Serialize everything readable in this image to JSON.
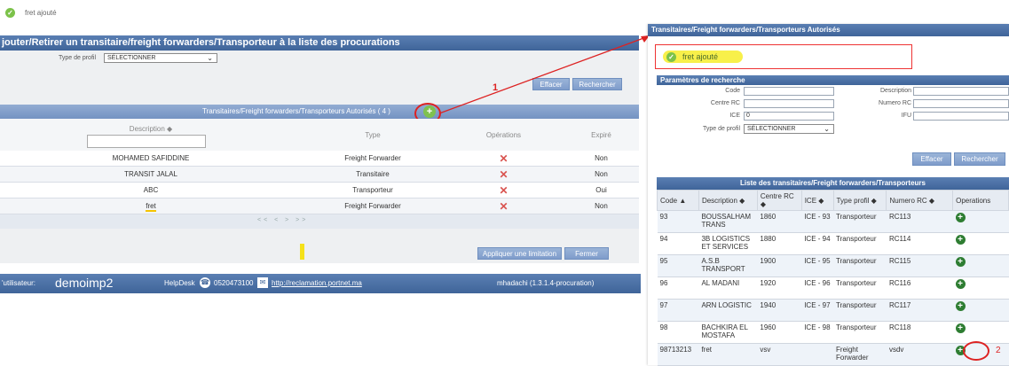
{
  "top_notice": {
    "text": "fret ajouté"
  },
  "left": {
    "title": "jouter/Retirer un transitaire/freight forwarders/Transporteur à la liste des procurations",
    "profile_label": "Type de profil",
    "profile_value": "SÉLECTIONNER",
    "clear_btn": "Effacer",
    "search_btn": "Rechercher",
    "grid_title": "Transitaires/Freight forwarders/Transporteurs Autorisés ( 4 )",
    "col_description": "Description",
    "col_type": "Type",
    "col_operations": "Opérations",
    "col_expire": "Expiré",
    "rows": [
      {
        "description": "MOHAMED SAFIDDINE",
        "type": "Freight Forwarder",
        "expire": "Non"
      },
      {
        "description": "TRANSIT JALAL",
        "type": "Transitaire",
        "expire": "Non"
      },
      {
        "description": "ABC",
        "type": "Transporteur",
        "expire": "Oui"
      },
      {
        "description": "fret",
        "type": "Freight Forwarder",
        "expire": "Non"
      }
    ],
    "pager": "<< < > >>",
    "apply_btn": "Appliquer une limitation",
    "close_btn": "Fermer"
  },
  "footer": {
    "user_label": "'utilisateur:",
    "user_name": "demoimp2",
    "helpdesk_label": "HelpDesk",
    "phone": "0520473100",
    "link": "http://reclamation.portnet.ma",
    "version": "mhadachi (1.3.1.4-procuration)"
  },
  "annotations": {
    "one": "1",
    "two": "2"
  },
  "right": {
    "title": "Transitaires/Freight forwarders/Transporteurs Autorisés",
    "notice": "fret ajouté",
    "params_title": "Paramètres de recherche",
    "labels": {
      "code": "Code",
      "centre_rc": "Centre RC",
      "ice": "ICE",
      "type_profil": "Type de profil",
      "description": "Description",
      "numero_rc": "Numero RC",
      "ifu": "IFU"
    },
    "ice_value": "0",
    "profile_value": "SÉLECTIONNER",
    "clear_btn": "Effacer",
    "search_btn": "Rechercher",
    "list_title": "Liste des transitaires/Freight forwarders/Transporteurs",
    "columns": [
      "Code ▲",
      "Description ◆",
      "Centre RC ◆",
      "ICE ◆",
      "Type profil ◆",
      "Numero RC ◆",
      "Operations"
    ],
    "rows": [
      {
        "code": "93",
        "description": "BOUSSALHAM TRANS",
        "centre": "1860",
        "ice": "ICE - 93",
        "type": "Transporteur",
        "rc": "RC113"
      },
      {
        "code": "94",
        "description": "3B LOGISTICS ET SERVICES",
        "centre": "1880",
        "ice": "ICE - 94",
        "type": "Transporteur",
        "rc": "RC114"
      },
      {
        "code": "95",
        "description": "A.S.B TRANSPORT",
        "centre": "1900",
        "ice": "ICE - 95",
        "type": "Transporteur",
        "rc": "RC115"
      },
      {
        "code": "96",
        "description": "AL MADANI",
        "centre": "1920",
        "ice": "ICE - 96",
        "type": "Transporteur",
        "rc": "RC116"
      },
      {
        "code": "97",
        "description": "ARN LOGISTIC",
        "centre": "1940",
        "ice": "ICE - 97",
        "type": "Transporteur",
        "rc": "RC117"
      },
      {
        "code": "98",
        "description": "BACHKIRA EL MOSTAFA",
        "centre": "1960",
        "ice": "ICE - 98",
        "type": "Transporteur",
        "rc": "RC118"
      },
      {
        "code": "98713213",
        "description": "fret",
        "centre": "vsv",
        "ice": "",
        "type": "Freight Forwarder",
        "rc": "vsdv"
      }
    ]
  }
}
